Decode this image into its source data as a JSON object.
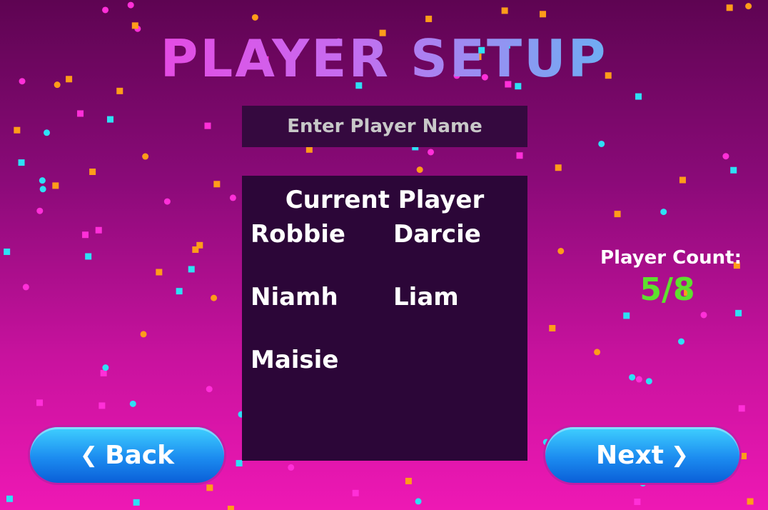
{
  "title": "PLAYER SETUP",
  "name_input": {
    "placeholder": "Enter Player Name",
    "value": ""
  },
  "players_panel": {
    "heading": "Current Player",
    "players": [
      "Robbie",
      "Darcie",
      "Niamh",
      "Liam",
      "Maisie"
    ]
  },
  "player_count": {
    "label": "Player Count:",
    "value": "5/8",
    "current": 5,
    "max": 8
  },
  "buttons": {
    "back_label": "Back",
    "back_icon": "chevron-left-icon",
    "next_label": "Next",
    "next_icon": "chevron-right-icon"
  },
  "colors": {
    "background_top": "#5e0452",
    "background_bottom": "#ee18b4",
    "panel": "#2c0638",
    "input": "#35093f",
    "count_value": "#5de02e",
    "button_blue": "#1c8cf0",
    "confetti": [
      "#ff9c1a",
      "#2ee0f5",
      "#ff2fd8"
    ]
  }
}
